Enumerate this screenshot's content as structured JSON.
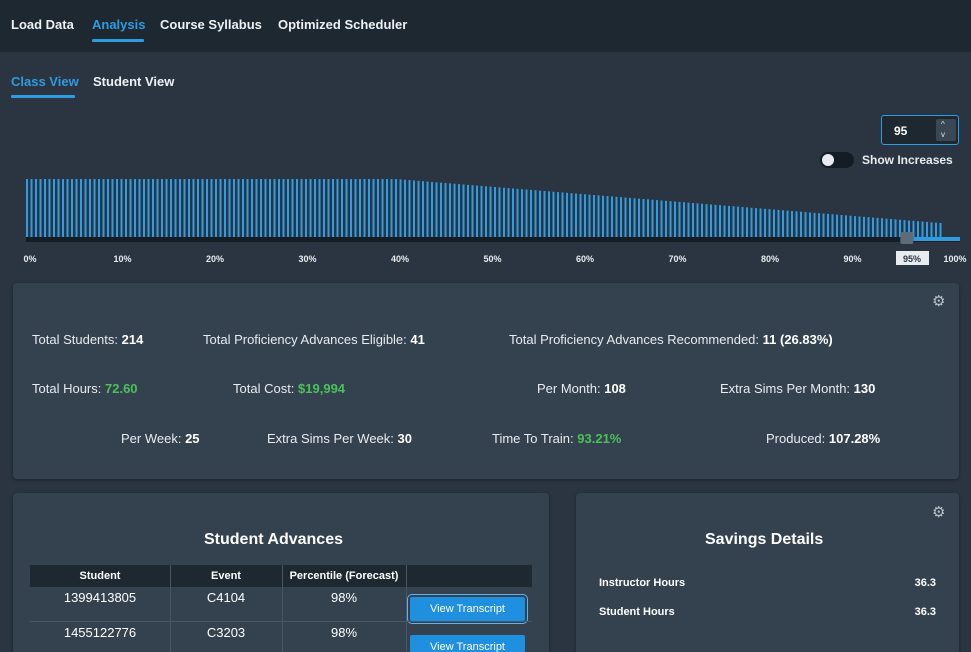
{
  "nav": {
    "tabs": [
      {
        "label": "Load Data"
      },
      {
        "label": "Analysis"
      },
      {
        "label": "Course Syllabus"
      },
      {
        "label": "Optimized Scheduler"
      }
    ],
    "active": "Analysis"
  },
  "subnav": {
    "tabs": [
      {
        "label": "Class View"
      },
      {
        "label": "Student View"
      }
    ],
    "active": "Class View"
  },
  "controls": {
    "threshold_value": "95",
    "spin_up": "^",
    "spin_down": "v",
    "show_increases_label": "Show Increases",
    "show_increases_on": false
  },
  "chart_data": {
    "type": "bar",
    "xlabel": "",
    "ylabel": "",
    "x_ticks": [
      "0%",
      "10%",
      "20%",
      "30%",
      "40%",
      "50%",
      "60%",
      "70%",
      "80%",
      "90%",
      "100%"
    ],
    "slider_value_label": "95%",
    "slider_value": 0.95,
    "bar_color": "#2f9be0",
    "values": [
      1,
      1,
      1,
      1,
      1,
      1,
      1,
      1,
      1,
      1,
      1,
      1,
      1,
      1,
      1,
      1,
      1,
      1,
      1,
      1,
      1,
      1,
      1,
      1,
      1,
      1,
      1,
      1,
      1,
      1,
      1,
      1,
      1,
      1,
      1,
      1,
      1,
      1,
      1,
      1,
      1,
      1,
      1,
      1,
      1,
      1,
      1,
      1,
      1,
      1,
      1,
      1,
      1,
      1,
      1,
      1,
      1,
      1,
      1,
      1,
      1,
      1,
      1,
      1,
      1,
      1,
      1,
      1,
      1,
      1,
      1,
      1,
      1,
      1,
      1,
      1,
      1,
      1,
      1,
      1,
      1,
      1,
      1,
      0.99,
      0.98,
      0.97,
      0.96,
      0.95,
      0.94,
      0.93,
      0.92,
      0.91,
      0.9,
      0.89,
      0.88,
      0.87,
      0.86,
      0.85,
      0.84,
      0.83,
      0.82,
      0.81,
      0.8,
      0.79,
      0.78,
      0.77,
      0.76,
      0.75,
      0.74,
      0.73,
      0.72,
      0.71,
      0.7,
      0.69,
      0.68,
      0.67,
      0.66,
      0.65,
      0.64,
      0.63,
      0.62,
      0.61,
      0.6,
      0.59,
      0.58,
      0.57,
      0.56,
      0.55,
      0.54,
      0.53,
      0.52,
      0.51,
      0.5,
      0.49,
      0.48,
      0.47,
      0.46,
      0.45,
      0.44,
      0.43,
      0.42,
      0.41,
      0.4,
      0.39,
      0.38,
      0.37,
      0.36,
      0.35,
      0.34,
      0.33,
      0.32,
      0.31,
      0.3,
      0.29,
      0.28,
      0.27,
      0.26,
      0.25,
      0.24,
      0.23,
      0.22,
      0.21,
      0.2,
      0.19,
      0.18,
      0.17,
      0.16,
      0.15,
      0.14,
      0.13,
      0.12,
      0.11,
      0.1,
      0.09,
      0.08,
      0.07,
      0.06,
      0.05,
      0.04,
      0.03,
      0.02,
      0.01,
      0.0,
      -0.01,
      -0.02,
      -0.03,
      -0.04,
      -0.05,
      -0.06,
      -0.07,
      -0.08,
      -0.09,
      -0.1,
      -0.11,
      -0.12,
      -0.13,
      -0.14,
      -0.15,
      -0.16,
      -0.17,
      -0.18,
      -0.19,
      -0.2,
      -0.21
    ]
  },
  "summary": {
    "total_students_label": "Total Students:",
    "total_students": "214",
    "eligible_label": "Total Proficiency Advances Eligible:",
    "eligible": "41",
    "recommended_label": "Total Proficiency Advances Recommended:",
    "recommended": "11 (26.83%)",
    "total_hours_label": "Total Hours:",
    "total_hours": "72.60",
    "total_cost_label": "Total Cost:",
    "total_cost": "$19,994",
    "per_month_label": "Per Month:",
    "per_month": "108",
    "extra_sims_month_label": "Extra Sims Per Month:",
    "extra_sims_month": "130",
    "per_week_label": "Per Week:",
    "per_week": "25",
    "extra_sims_week_label": "Extra Sims Per Week:",
    "extra_sims_week": "30",
    "time_to_train_label": "Time To Train:",
    "time_to_train": "93.21%",
    "produced_label": "Produced:",
    "produced": "107.28%",
    "green": "#4cc05a"
  },
  "advances": {
    "title": "Student Advances",
    "columns": [
      "Student",
      "Event",
      "Percentile (Forecast)"
    ],
    "rows": [
      {
        "student": "1399413805",
        "event": "C4104",
        "percentile": "98%",
        "action": "View Transcript"
      },
      {
        "student": "1455122776",
        "event": "C3203",
        "percentile": "98%",
        "action": "View Transcript"
      }
    ]
  },
  "savings": {
    "title": "Savings Details",
    "items": [
      {
        "label": "Instructor Hours",
        "value": "36.3"
      },
      {
        "label": "Student Hours",
        "value": "36.3"
      }
    ]
  },
  "icons": {
    "gear": "⚙"
  }
}
